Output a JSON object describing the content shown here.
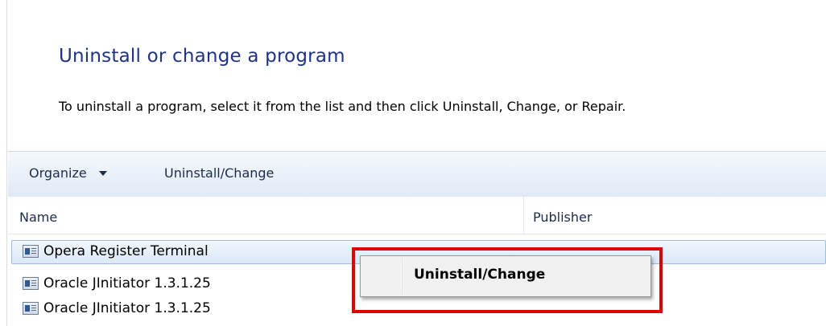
{
  "page": {
    "title": "Uninstall or change a program",
    "subtitle": "To uninstall a program, select it from the list and then click Uninstall, Change, or Repair."
  },
  "toolbar": {
    "organize_label": "Organize",
    "organize_caret_icon": "chevron-down-icon",
    "uninstall_label": "Uninstall/Change"
  },
  "columns": {
    "name": "Name",
    "publisher": "Publisher"
  },
  "programs": [
    {
      "name": "Opera Register Terminal",
      "icon": "program-icon",
      "selected": true
    },
    {
      "name": "Oracle JInitiator 1.3.1.25",
      "icon": "program-icon",
      "selected": false
    },
    {
      "name": "Oracle JInitiator 1.3.1.25",
      "icon": "program-icon",
      "selected": false
    }
  ],
  "context_menu": {
    "item_label": "Uninstall/Change",
    "highlight_color": "#e00000"
  },
  "colors": {
    "title": "#1e3287",
    "toolbar_gradient_top": "#f4f8fc",
    "toolbar_gradient_bottom": "#dfe9f5",
    "selection_border": "#9fbbdc"
  }
}
